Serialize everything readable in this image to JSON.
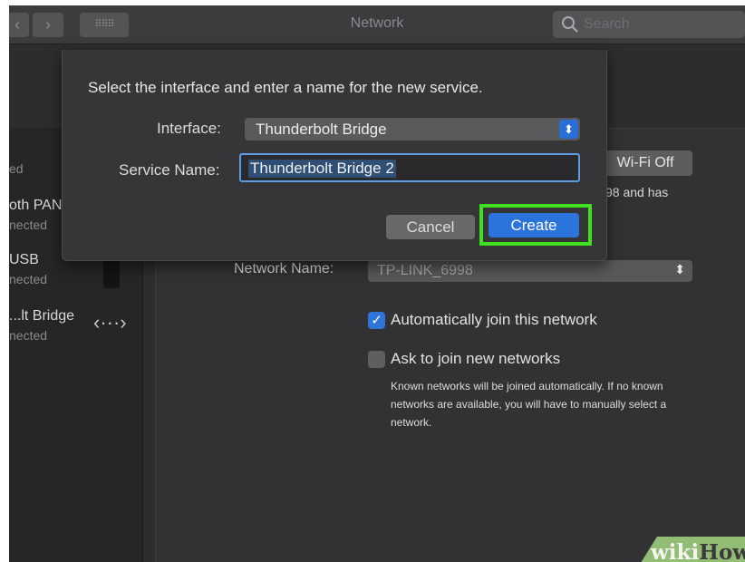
{
  "window": {
    "title": "Network",
    "search_placeholder": "Search",
    "grid_glyph": "⠿⠿⠿"
  },
  "sidebar": {
    "items": [
      {
        "name": "",
        "status": "ed"
      },
      {
        "name": "oth PAN",
        "status": "nected"
      },
      {
        "name": "USB",
        "status": "nected"
      },
      {
        "name": "...lt Bridge",
        "status": "nected"
      }
    ],
    "bridge_glyph": "‹···›"
  },
  "detail": {
    "wifi_button": "Wi-Fi Off",
    "status_partial": "98 and has",
    "network_name_label": "Network Name:",
    "network_name_value": "TP-LINK_6998",
    "auto_join_label": "Automatically join this network",
    "auto_join_checked": true,
    "ask_join_label": "Ask to join new networks",
    "ask_join_checked": false,
    "help_text": "Known networks will be joined automatically. If no known networks are available, you will have to manually select a network."
  },
  "dialog": {
    "prompt": "Select the interface and enter a name for the new service.",
    "interface_label": "Interface:",
    "interface_value": "Thunderbolt Bridge",
    "service_name_label": "Service Name:",
    "service_name_value": "Thunderbolt Bridge 2",
    "cancel_label": "Cancel",
    "create_label": "Create"
  },
  "highlight_color": "#3ee21f",
  "watermark": {
    "part1": "wiki",
    "part2": "How"
  }
}
